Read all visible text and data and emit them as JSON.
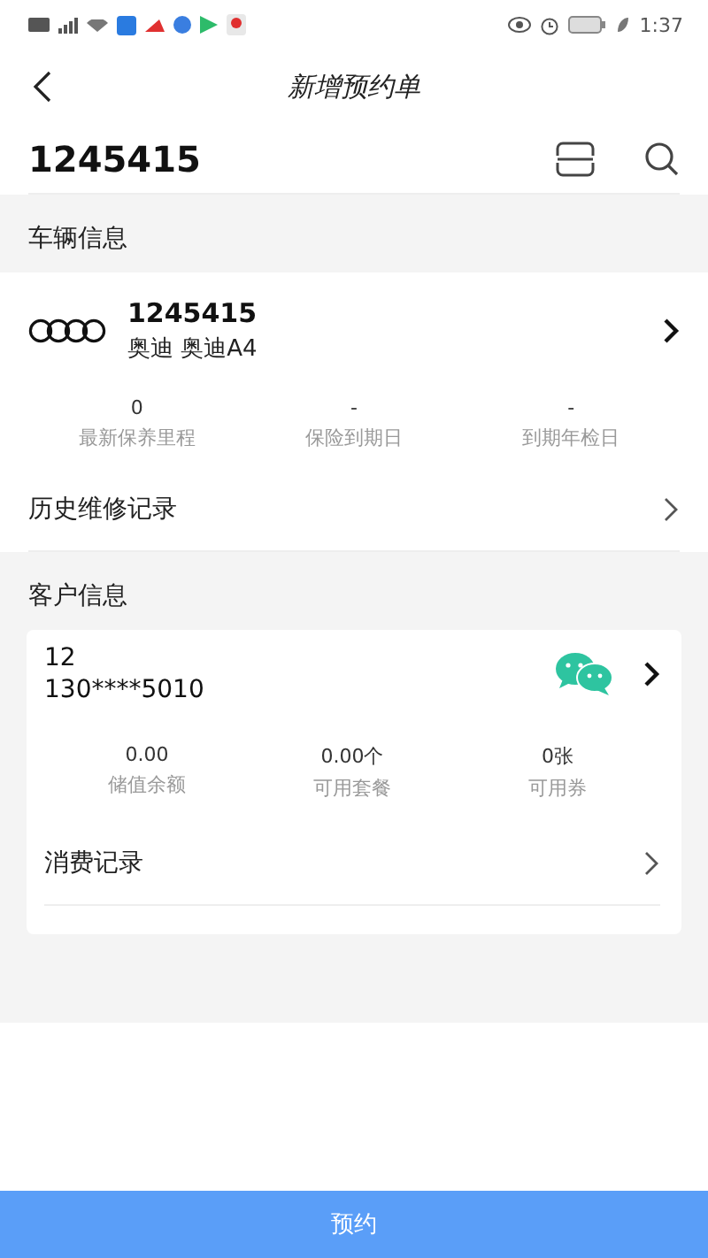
{
  "status_bar": {
    "time": "1:37"
  },
  "header": {
    "title": "新增预约单"
  },
  "search": {
    "value": "1245415"
  },
  "vehicle_section": {
    "title": "车辆信息",
    "plate": "1245415",
    "model": "奥迪 奥迪A4",
    "stats": [
      {
        "value": "0",
        "label": "最新保养里程"
      },
      {
        "value": "-",
        "label": "保险到期日"
      },
      {
        "value": "-",
        "label": "到期年检日"
      }
    ],
    "link": "历史维修记录"
  },
  "customer_section": {
    "title": "客户信息",
    "name": "12",
    "phone": "130****5010",
    "stats": [
      {
        "value": "0.00",
        "label": "储值余额"
      },
      {
        "value": "0.00个",
        "label": "可用套餐"
      },
      {
        "value": "0张",
        "label": "可用券"
      }
    ],
    "link": "消费记录"
  },
  "submit_button": "预约"
}
